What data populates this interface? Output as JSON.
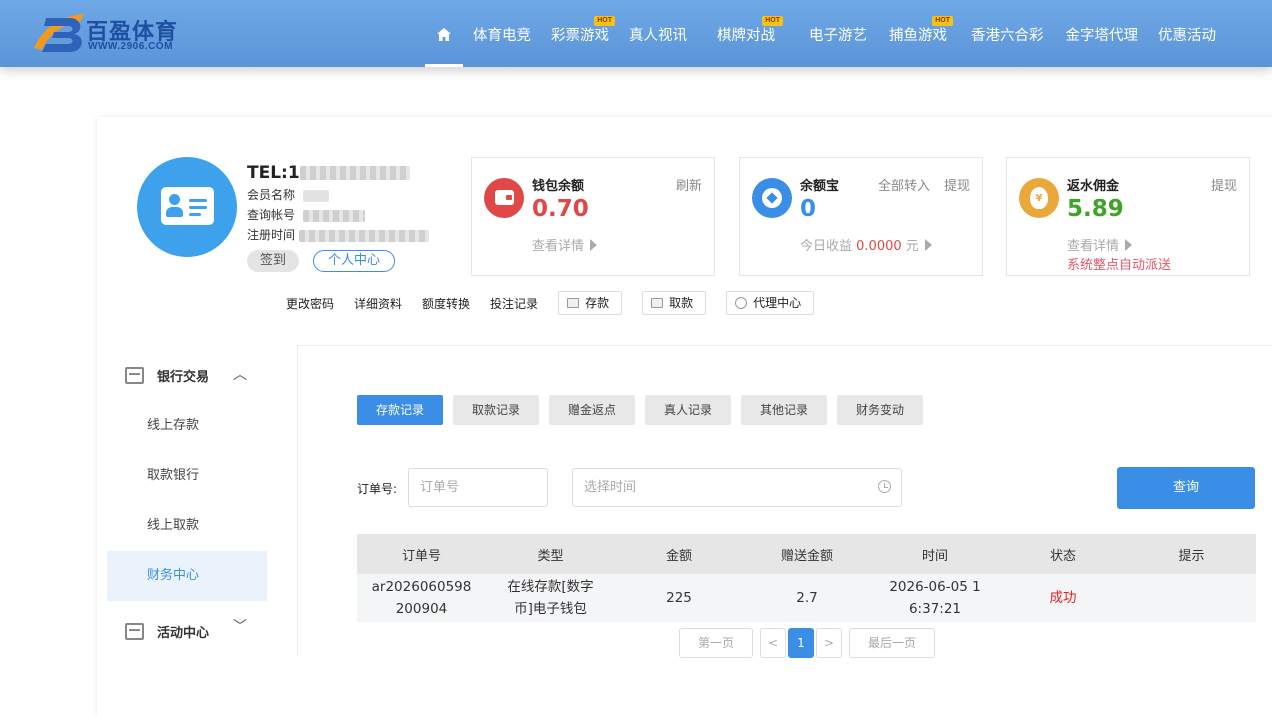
{
  "brand": {
    "name": "百盈体育",
    "url": "WWW.2906.COM"
  },
  "nav": {
    "items": [
      {
        "label": "体育电竞",
        "hot": false
      },
      {
        "label": "彩票游戏",
        "hot": true
      },
      {
        "label": "真人视讯",
        "hot": false
      },
      {
        "label": "棋牌对战",
        "hot": true
      },
      {
        "label": "电子游艺",
        "hot": false
      },
      {
        "label": "捕鱼游戏",
        "hot": true
      },
      {
        "label": "香港六合彩",
        "hot": false
      },
      {
        "label": "金字塔代理",
        "hot": false
      },
      {
        "label": "优惠活动",
        "hot": false
      }
    ],
    "hot_badge": "HOT"
  },
  "profile": {
    "tel": "TEL:1",
    "member_name_label": "会员名称",
    "account_label": "查询帐号",
    "register_label": "注册时间",
    "sign_in": "签到",
    "personal_center": "个人中心"
  },
  "wallet": {
    "title": "钱包余额",
    "action": "刷新",
    "value": "0.70",
    "detail": "查看详情"
  },
  "yuebao": {
    "title": "余额宝",
    "action1": "全部转入",
    "action2": "提现",
    "value": "0",
    "today_label": "今日收益",
    "today_value": "0.0000",
    "unit": "元"
  },
  "rebate": {
    "title": "返水佣金",
    "action": "提现",
    "value": "5.89",
    "detail": "查看详情",
    "note": "系统整点自动派送"
  },
  "quick_links": {
    "change_password": "更改密码",
    "details": "详细资料",
    "transfer": "额度转换",
    "bet_records": "投注记录",
    "deposit": "存款",
    "withdraw": "取款",
    "agent": "代理中心"
  },
  "sidebar": {
    "bank_section": "银行交易",
    "items": [
      "线上存款",
      "取款银行",
      "线上取款",
      "财务中心"
    ],
    "activity_section": "活动中心"
  },
  "tabs": [
    "存款记录",
    "取款记录",
    "赠金返点",
    "真人记录",
    "其他记录",
    "财务变动"
  ],
  "filter": {
    "order_label": "订单号:",
    "order_placeholder": "订单号",
    "time_placeholder": "选择时间",
    "query": "查询"
  },
  "table": {
    "headers": [
      "订单号",
      "类型",
      "金额",
      "赠送金额",
      "时间",
      "状态",
      "提示"
    ],
    "rows": [
      {
        "order": "ar2026060598\n200904",
        "type": "在线存款[数字\n币]电子钱包",
        "amount": "225",
        "bonus": "2.7",
        "time": "2026-06-05 1\n6:37:21",
        "status": "成功",
        "tip": ""
      }
    ]
  },
  "pagination": {
    "first": "第一页",
    "prev": "<",
    "current": "1",
    "next": ">",
    "last": "最后一页"
  },
  "colors": {
    "accent": "#3a8ee6",
    "wallet": "#e04848",
    "yuebao": "#3a8ee6",
    "rebate": "#3fa32a",
    "success": "#e02020"
  }
}
